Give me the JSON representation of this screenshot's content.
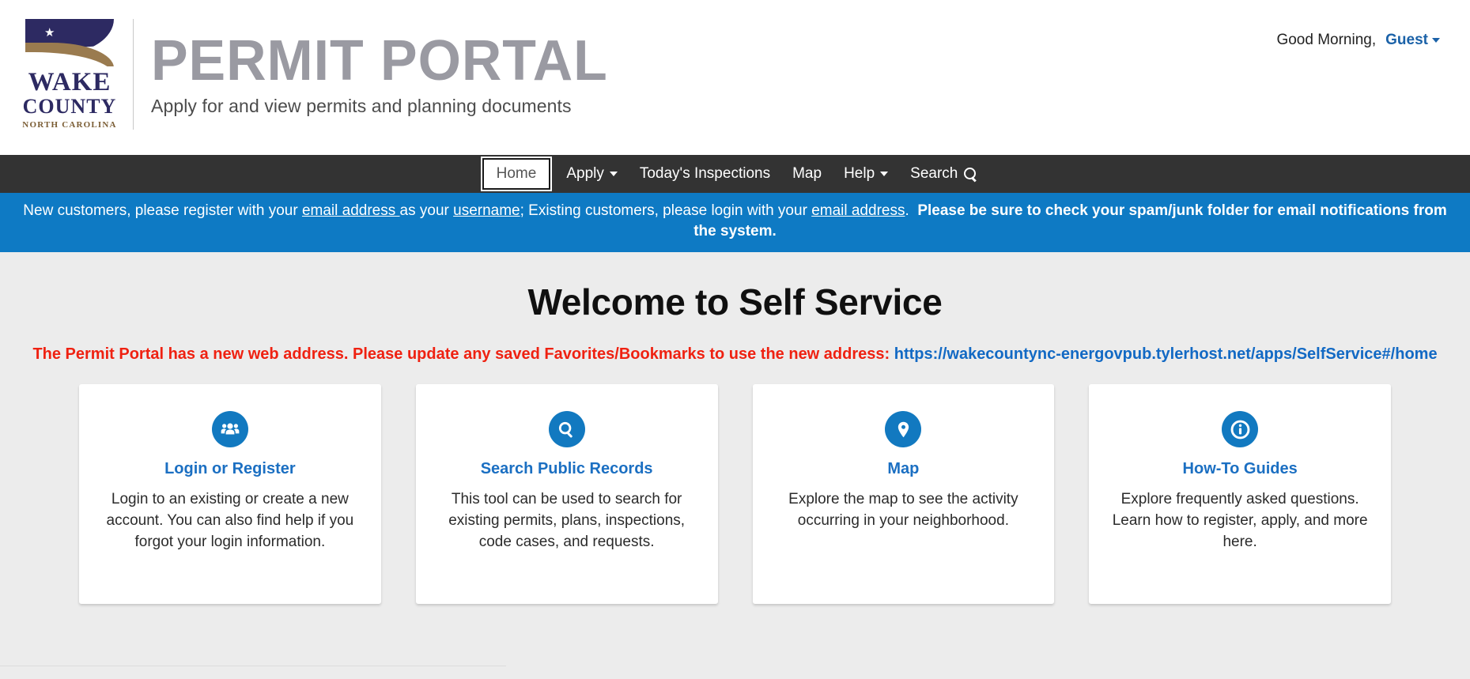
{
  "header": {
    "logo": {
      "seal_line1": "WAKE",
      "seal_line2": "COUNTY",
      "seal_line3": "NORTH CAROLINA",
      "star_glyph": "★"
    },
    "portal_title": "PERMIT PORTAL",
    "portal_subtitle": "Apply for and view permits and planning documents",
    "greeting_text": "Good Morning,",
    "user_label": "Guest"
  },
  "nav": {
    "items": [
      {
        "label": "Home",
        "active": true,
        "caret": false,
        "search": false
      },
      {
        "label": "Apply",
        "active": false,
        "caret": true,
        "search": false
      },
      {
        "label": "Today's Inspections",
        "active": false,
        "caret": false,
        "search": false
      },
      {
        "label": "Map",
        "active": false,
        "caret": false,
        "search": false
      },
      {
        "label": "Help",
        "active": false,
        "caret": true,
        "search": false
      },
      {
        "label": "Search",
        "active": false,
        "caret": false,
        "search": true
      }
    ]
  },
  "banner": {
    "part1": "New customers, please register with your ",
    "link1": "email address ",
    "part2": "as your ",
    "link2": "username",
    "part3": "; Existing customers, please login with your ",
    "link3": "email address",
    "part4": ".",
    "bold": "Please be sure to check your spam/junk folder for email notifications from the system."
  },
  "main": {
    "page_title": "Welcome to Self Service",
    "notice_text": "The Permit Portal has a new web address. Please update any saved Favorites/Bookmarks to use the new address: ",
    "notice_url": "https://wakecountync-energovpub.tylerhost.net/apps/SelfService#/home"
  },
  "cards": [
    {
      "icon": "users-icon",
      "title": "Login or Register",
      "desc": "Login to an existing or create a new account. You can also find help if you forgot your login information."
    },
    {
      "icon": "search-icon",
      "title": "Search Public Records",
      "desc": "This tool can be used to search for existing permits, plans, inspections, code cases, and requests."
    },
    {
      "icon": "map-pin-icon",
      "title": "Map",
      "desc": "Explore the map to see the activity occurring in your neighborhood."
    },
    {
      "icon": "info-icon",
      "title": "How-To Guides",
      "desc": "Explore frequently asked questions. Learn how to register, apply, and more here."
    }
  ],
  "colors": {
    "nav_bg": "#333333",
    "banner_bg": "#0e7ac4",
    "accent_blue": "#1279c0",
    "link_blue": "#1b62a8",
    "notice_red": "#ef2111",
    "seal_navy": "#2d2a62",
    "seal_tan": "#9a7b4f",
    "page_bg": "#ececec"
  }
}
